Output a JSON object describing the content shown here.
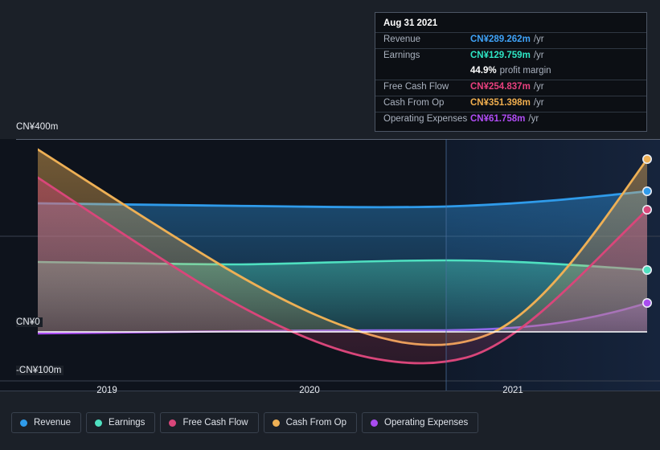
{
  "tooltip": {
    "date": "Aug 31 2021",
    "rows": [
      {
        "label": "Revenue",
        "value": "CN¥289.262m",
        "unit": "/yr",
        "color": "#3fa2f7"
      },
      {
        "label": "Earnings",
        "value": "CN¥129.759m",
        "unit": "/yr",
        "color": "#2ee6c5"
      },
      {
        "label": "Free Cash Flow",
        "value": "CN¥254.837m",
        "unit": "/yr",
        "color": "#e8407e"
      },
      {
        "label": "Cash From Op",
        "value": "CN¥351.398m",
        "unit": "/yr",
        "color": "#f0ae4e"
      },
      {
        "label": "Operating Expenses",
        "value": "CN¥61.758m",
        "unit": "/yr",
        "color": "#b14cf5"
      }
    ],
    "profit_margin_value": "44.9%",
    "profit_margin_text": "profit margin"
  },
  "legend": {
    "items": [
      {
        "label": "Revenue",
        "color": "#2f9bea"
      },
      {
        "label": "Earnings",
        "color": "#4fe0c0"
      },
      {
        "label": "Free Cash Flow",
        "color": "#d9467a"
      },
      {
        "label": "Cash From Op",
        "color": "#eeb055"
      },
      {
        "label": "Operating Expenses",
        "color": "#a94cf0"
      }
    ]
  },
  "axes": {
    "y_labels": [
      "CN¥400m",
      "CN¥0",
      "-CN¥100m"
    ],
    "x_labels": [
      "2019",
      "2020",
      "2021"
    ]
  },
  "chart_data": {
    "type": "area",
    "title": "",
    "xlabel": "",
    "ylabel": "CN¥",
    "ylim": [
      -100,
      400
    ],
    "xlim": [
      "2018-08",
      "2021-08"
    ],
    "grid": true,
    "legend_position": "bottom",
    "x_ticks": [
      "2019",
      "2020",
      "2021"
    ],
    "y_ticks": [
      400,
      200,
      0,
      -100
    ],
    "currency": "CN¥",
    "unit": "m",
    "highlight_cursor_x": "2020-08",
    "series": [
      {
        "name": "Revenue",
        "color": "#2f9bea",
        "x": [
          "2018-08",
          "2019-02",
          "2019-08",
          "2020-02",
          "2020-08",
          "2021-02",
          "2021-08"
        ],
        "values": [
          266,
          264,
          262,
          259,
          262,
          272,
          289.262
        ]
      },
      {
        "name": "Earnings",
        "color": "#4fe0c0",
        "x": [
          "2018-08",
          "2019-02",
          "2019-08",
          "2020-02",
          "2020-08",
          "2021-02",
          "2021-08"
        ],
        "values": [
          145,
          143,
          140,
          143,
          146,
          143,
          129.759
        ]
      },
      {
        "name": "Free Cash Flow",
        "color": "#d9467a",
        "x": [
          "2018-08",
          "2019-02",
          "2019-08",
          "2020-02",
          "2020-08",
          "2021-02",
          "2021-08"
        ],
        "values": [
          315,
          210,
          90,
          -22,
          -63,
          -10,
          254.837
        ]
      },
      {
        "name": "Cash From Op",
        "color": "#eeb055",
        "x": [
          "2018-08",
          "2019-02",
          "2019-08",
          "2020-02",
          "2020-08",
          "2021-02",
          "2021-08"
        ],
        "values": [
          372,
          285,
          195,
          85,
          -22,
          15,
          351.398
        ]
      },
      {
        "name": "Operating Expenses",
        "color": "#a94cf0",
        "x": [
          "2018-08",
          "2019-02",
          "2019-08",
          "2020-02",
          "2020-08",
          "2021-02",
          "2021-08"
        ],
        "values": [
          47,
          48,
          49,
          50,
          50,
          53,
          61.758
        ]
      }
    ]
  }
}
